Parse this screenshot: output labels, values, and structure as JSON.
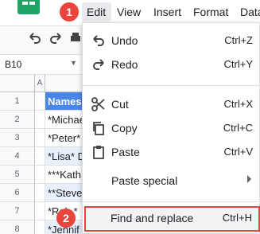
{
  "menubar": {
    "items": [
      "Edit",
      "View",
      "Insert",
      "Format",
      "Data"
    ]
  },
  "badges": [
    "1",
    "2"
  ],
  "formula_bar": {
    "cell_ref": "B10"
  },
  "grid": {
    "columns": [
      "A"
    ],
    "rows": [
      {
        "num": "1",
        "value": "Names"
      },
      {
        "num": "2",
        "value": "*Michael*"
      },
      {
        "num": "3",
        "value": "*Peter*"
      },
      {
        "num": "4",
        "value": "*Lisa* D"
      },
      {
        "num": "5",
        "value": "***Kath"
      },
      {
        "num": "6",
        "value": "**Steve"
      },
      {
        "num": "7",
        "value": "*Rob.*"
      },
      {
        "num": "8",
        "value": "*Jennif"
      }
    ]
  },
  "edit_menu": {
    "undo": {
      "label": "Undo",
      "shortcut": "Ctrl+Z"
    },
    "redo": {
      "label": "Redo",
      "shortcut": "Ctrl+Y"
    },
    "cut": {
      "label": "Cut",
      "shortcut": "Ctrl+X"
    },
    "copy": {
      "label": "Copy",
      "shortcut": "Ctrl+C"
    },
    "paste": {
      "label": "Paste",
      "shortcut": "Ctrl+V"
    },
    "paste_special": {
      "label": "Paste special"
    },
    "find_replace": {
      "label": "Find and replace",
      "shortcut": "Ctrl+H"
    }
  },
  "colors": {
    "accent": "#1fa463",
    "header_fill": "#4a86e8",
    "badge": "#e8453c"
  },
  "icons": [
    "undo-icon",
    "redo-icon",
    "cut-icon",
    "copy-icon",
    "paste-icon"
  ]
}
